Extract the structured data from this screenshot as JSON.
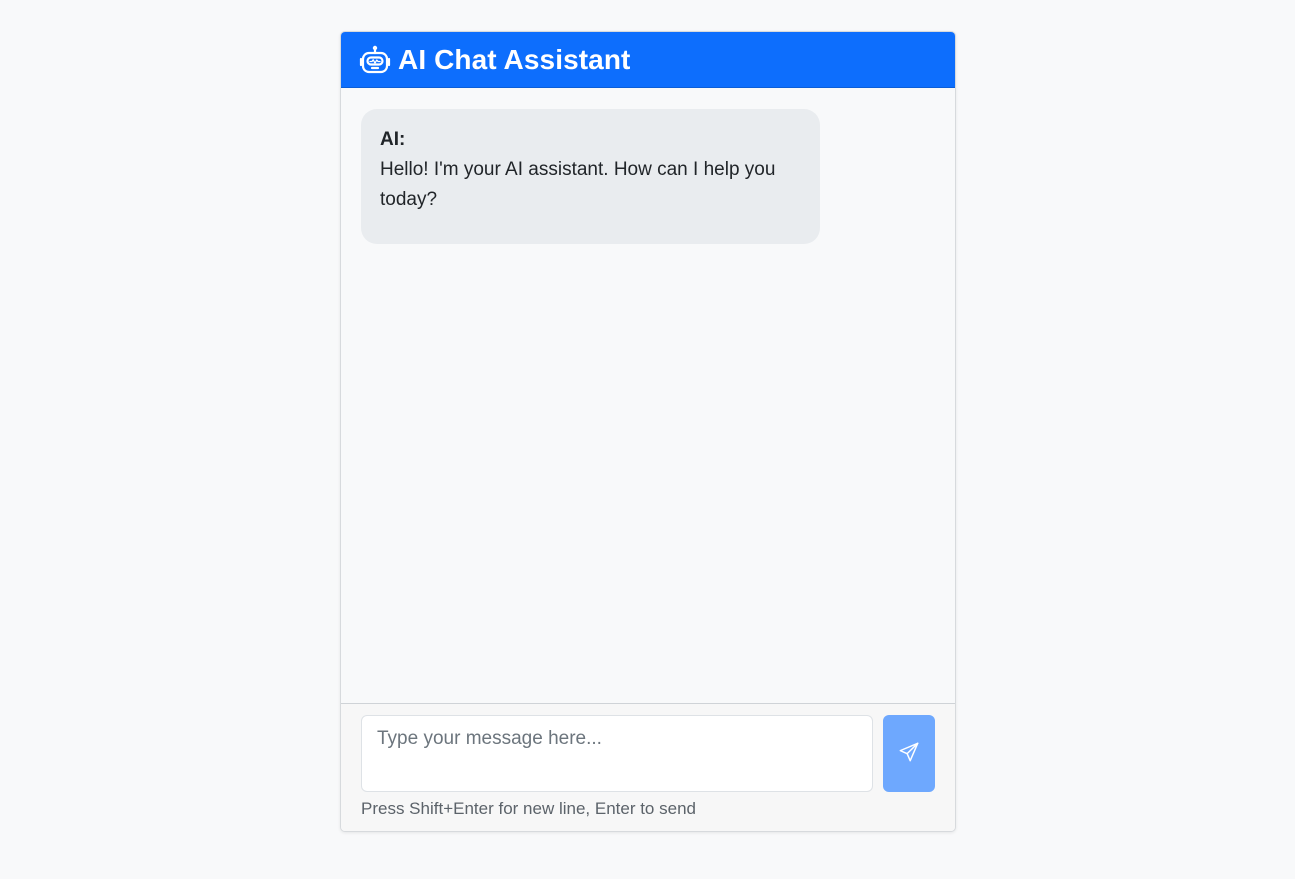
{
  "header": {
    "title": "AI Chat Assistant",
    "icon": "robot-icon"
  },
  "messages": [
    {
      "sender": "AI:",
      "text": "Hello! I'm your AI assistant. How can I help you today?"
    }
  ],
  "composer": {
    "placeholder": "Type your message here...",
    "value": "",
    "send_icon": "send-icon",
    "hint": "Press Shift+Enter for new line, Enter to send"
  },
  "colors": {
    "primary": "#0d6efd",
    "send_button": "#6ea8fe",
    "bubble": "#e9ecef",
    "background": "#f8f9fa"
  }
}
